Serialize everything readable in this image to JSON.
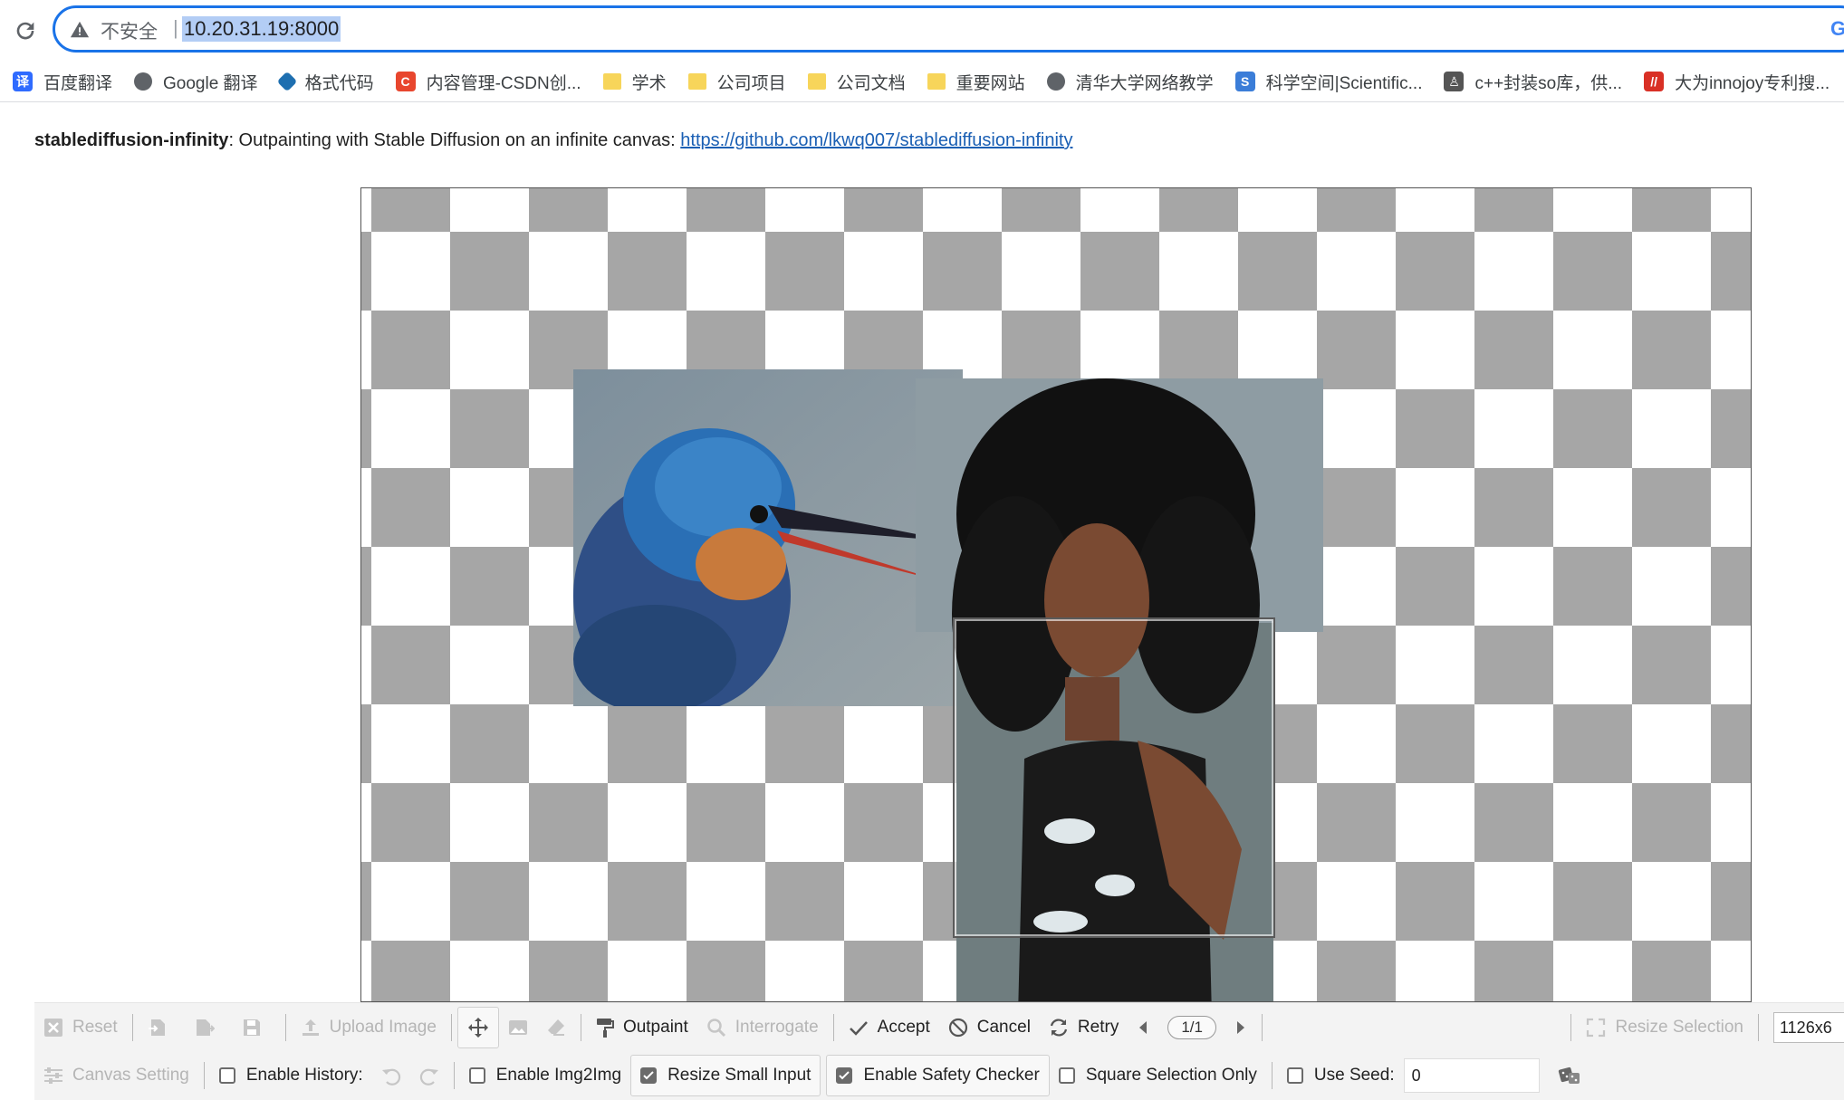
{
  "browser": {
    "insecure_label": "不安全",
    "separator": "|",
    "url": "10.20.31.19:8000",
    "bookmarks": [
      {
        "label": "百度翻译",
        "icon": "baidu-translate-icon",
        "color": "#2f6bff"
      },
      {
        "label": "Google 翻译",
        "icon": "globe-icon",
        "color": "#5f6368"
      },
      {
        "label": "格式代码",
        "icon": "diamond-icon",
        "color": "#1e6fb0"
      },
      {
        "label": "内容管理-CSDN创...",
        "icon": "csdn-icon",
        "color": "#e8462e"
      },
      {
        "label": "学术",
        "icon": "folder-icon",
        "color": "#f7d55a"
      },
      {
        "label": "公司项目",
        "icon": "folder-icon",
        "color": "#f7d55a"
      },
      {
        "label": "公司文档",
        "icon": "folder-icon",
        "color": "#f7d55a"
      },
      {
        "label": "重要网站",
        "icon": "folder-icon",
        "color": "#f7d55a"
      },
      {
        "label": "清华大学网络教学",
        "icon": "globe-icon",
        "color": "#5f6368"
      },
      {
        "label": "科学空间|Scientific...",
        "icon": "scientific-icon",
        "color": "#3b7dd8"
      },
      {
        "label": "c++封装so库，供...",
        "icon": "printer-icon",
        "color": "#555555"
      },
      {
        "label": "大为innojoy专利搜...",
        "icon": "innojoy-icon",
        "color": "#d93025"
      }
    ]
  },
  "intro": {
    "app_name": "stablediffusion-infinity",
    "description": ": Outpainting with Stable Diffusion on an infinite canvas: ",
    "link": "https://github.com/lkwq007/stablediffusion-infinity"
  },
  "toolbar": {
    "reset": "Reset",
    "upload_image": "Upload Image",
    "outpaint": "Outpaint",
    "interrogate": "Interrogate",
    "accept": "Accept",
    "cancel": "Cancel",
    "retry": "Retry",
    "page_counter": "1/1",
    "resize_selection": "Resize Selection",
    "size_value": "1126x6"
  },
  "settings": {
    "canvas_setting": "Canvas Setting",
    "enable_history": "Enable History:",
    "enable_img2img": "Enable Img2Img",
    "resize_small_input": "Resize Small Input",
    "enable_safety_checker": "Enable Safety Checker",
    "square_selection_only": "Square Selection Only",
    "use_seed": "Use Seed:",
    "seed_value": "0",
    "checked": {
      "enable_history": false,
      "enable_img2img": false,
      "resize_small_input": true,
      "enable_safety_checker": true,
      "square_selection_only": false,
      "use_seed": false
    }
  },
  "colors": {
    "accent": "#1a73e8",
    "link": "#1a5fb4",
    "checker_dark": "#a6a6a6",
    "checker_light": "#ffffff",
    "disabled": "#b5b5b5"
  }
}
